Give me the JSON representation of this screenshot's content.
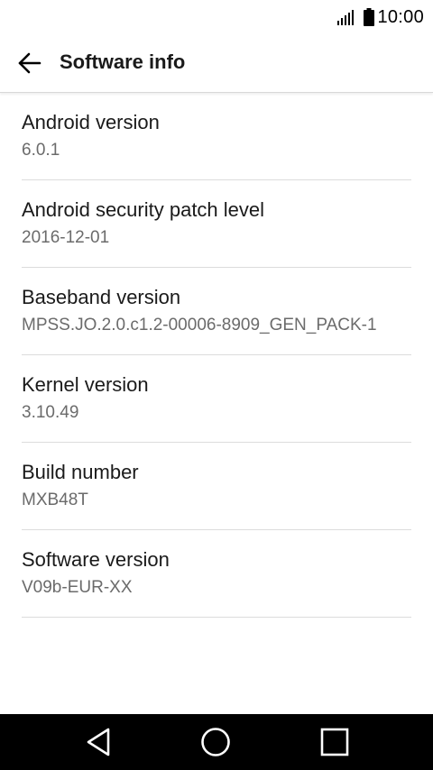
{
  "status_bar": {
    "time": "10:00",
    "icons": [
      "signal-icon",
      "battery-icon"
    ]
  },
  "app_bar": {
    "title": "Software info",
    "back_icon": "back-arrow-icon"
  },
  "items": [
    {
      "title": "Android version",
      "value": "6.0.1"
    },
    {
      "title": "Android security patch level",
      "value": "2016-12-01"
    },
    {
      "title": "Baseband version",
      "value": "MPSS.JO.2.0.c1.2-00006-8909_GEN_PACK-1"
    },
    {
      "title": "Kernel version",
      "value": "3.10.49"
    },
    {
      "title": "Build number",
      "value": "MXB48T"
    },
    {
      "title": "Software version",
      "value": "V09b-EUR-XX"
    }
  ],
  "nav_bar": {
    "buttons": [
      "back-triangle-icon",
      "home-circle-icon",
      "recents-square-icon"
    ]
  },
  "colors": {
    "title_text": "#1a1a1a",
    "value_text": "#6b6b6b",
    "divider": "#dcdcdc",
    "nav_background": "#000000"
  }
}
